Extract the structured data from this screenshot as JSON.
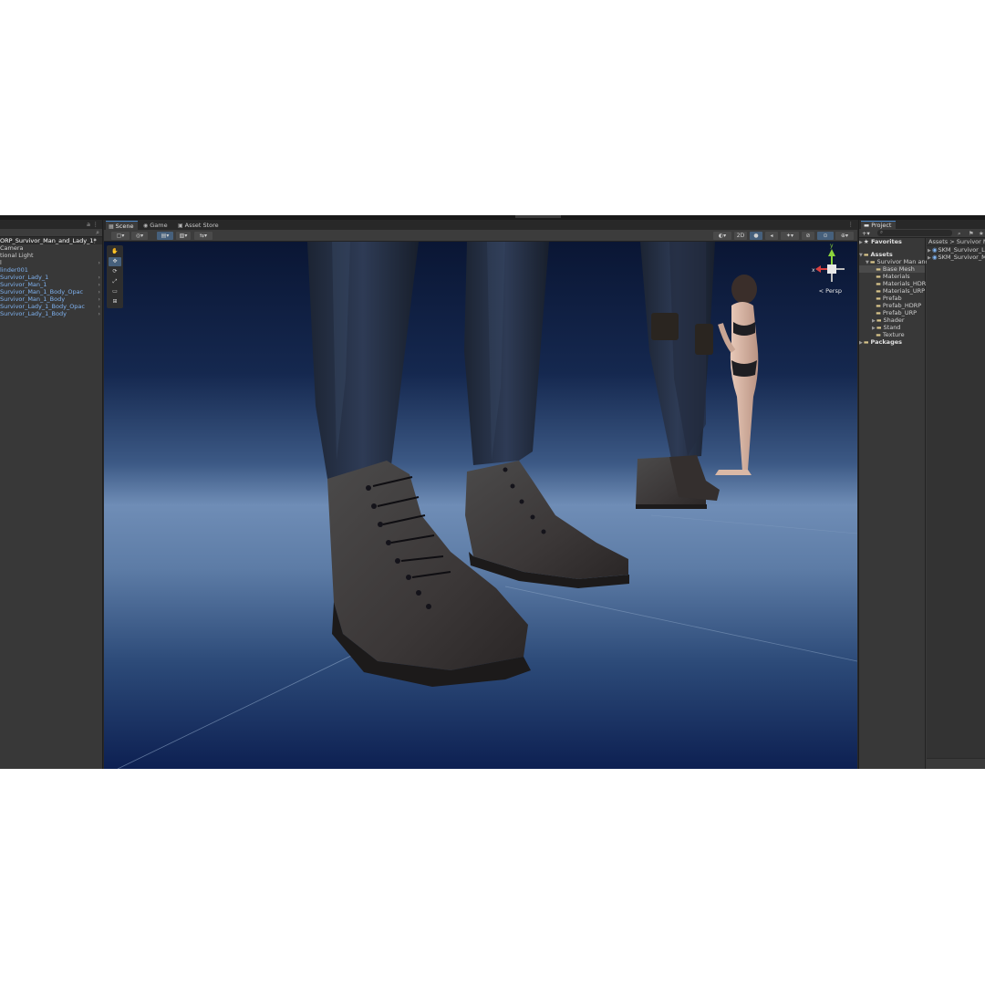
{
  "hierarchy": {
    "scene_name": "ORP_Survivor_Man_and_Lady_1*",
    "items": [
      {
        "label": "Camera",
        "prefab": false,
        "expandable": false
      },
      {
        "label": "tional Light",
        "prefab": false,
        "expandable": false
      },
      {
        "label": "l",
        "prefab": false,
        "expandable": true
      },
      {
        "label": "linder001",
        "prefab": true,
        "expandable": false
      },
      {
        "label": "Survivor_Lady_1",
        "prefab": true,
        "expandable": true
      },
      {
        "label": "Survivor_Man_1",
        "prefab": true,
        "expandable": true
      },
      {
        "label": "Survivor_Man_1_Body_Opac",
        "prefab": true,
        "expandable": true
      },
      {
        "label": "Survivor_Man_1_Body",
        "prefab": true,
        "expandable": true
      },
      {
        "label": "Survivor_Lady_1_Body_Opac",
        "prefab": true,
        "expandable": true
      },
      {
        "label": "Survivor_Lady_1_Body",
        "prefab": true,
        "expandable": true
      }
    ]
  },
  "scene_tabs": [
    {
      "label": "Scene",
      "icon": "scene-icon",
      "active": true
    },
    {
      "label": "Game",
      "icon": "game-controller-icon",
      "active": false
    },
    {
      "label": "Asset Store",
      "icon": "store-bag-icon",
      "active": false
    }
  ],
  "scene_toolbar": {
    "mode_2d_label": "2D",
    "persp_label": "Persp"
  },
  "project": {
    "tab_label": "Project",
    "search_placeholder": "",
    "favorites_label": "Favorites",
    "assets_label": "Assets",
    "folders": [
      {
        "label": "Survivor Man and",
        "depth": 1,
        "selected": false,
        "expanded": true
      },
      {
        "label": "Base Mesh",
        "depth": 2,
        "selected": true,
        "expanded": false
      },
      {
        "label": "Materials",
        "depth": 2,
        "selected": false,
        "expanded": false
      },
      {
        "label": "Materials_HDR",
        "depth": 2,
        "selected": false,
        "expanded": false
      },
      {
        "label": "Materials_URP",
        "depth": 2,
        "selected": false,
        "expanded": false
      },
      {
        "label": "Prefab",
        "depth": 2,
        "selected": false,
        "expanded": false
      },
      {
        "label": "Prefab_HDRP",
        "depth": 2,
        "selected": false,
        "expanded": false
      },
      {
        "label": "Prefab_URP",
        "depth": 2,
        "selected": false,
        "expanded": false
      },
      {
        "label": "Shader",
        "depth": 2,
        "selected": false,
        "expanded": false,
        "has_children": true
      },
      {
        "label": "Stand",
        "depth": 2,
        "selected": false,
        "expanded": false,
        "has_children": true
      },
      {
        "label": "Texture",
        "depth": 2,
        "selected": false,
        "expanded": false
      }
    ],
    "packages_label": "Packages",
    "breadcrumb": [
      "Assets",
      "Survivor Man"
    ],
    "files": [
      "SKM_Survivor_La",
      "SKM_Survivor_M"
    ]
  },
  "colors": {
    "accent": "#4a86c8",
    "prefab_text": "#7fb2f0",
    "sky_top": "#0b1a3c",
    "floor": "#5f7fa8"
  }
}
